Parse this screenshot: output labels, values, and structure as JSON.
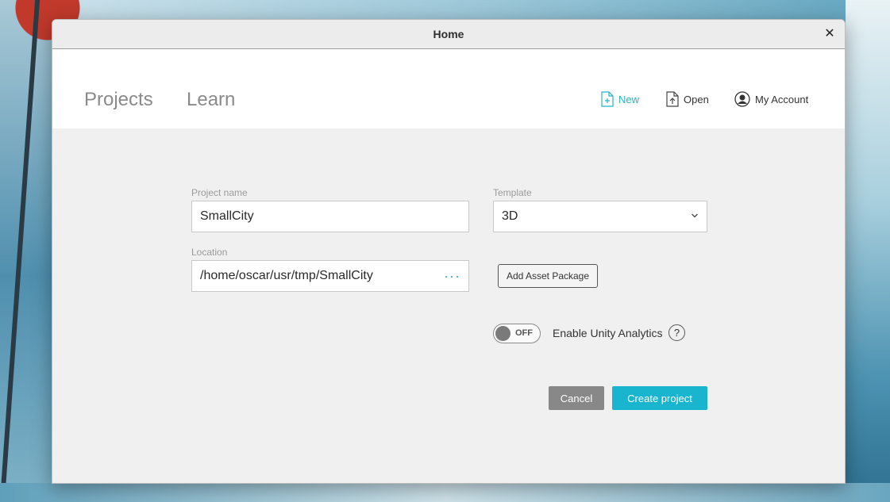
{
  "window": {
    "title": "Home"
  },
  "header": {
    "tabs": [
      {
        "label": "Projects"
      },
      {
        "label": "Learn"
      }
    ],
    "actions": {
      "new_label": "New",
      "open_label": "Open",
      "account_label": "My Account"
    },
    "accent_color": "#26b3c9"
  },
  "form": {
    "project_name_label": "Project name",
    "project_name_value": "SmallCity",
    "template_label": "Template",
    "template_value": "3D",
    "location_label": "Location",
    "location_value": "/home/oscar/usr/tmp/SmallCity",
    "location_browse": "···",
    "add_asset_label": "Add Asset Package",
    "analytics_toggle_state": "OFF",
    "analytics_label": "Enable Unity Analytics",
    "help_glyph": "?",
    "cancel_label": "Cancel",
    "create_label": "Create project"
  },
  "icons": {
    "close": "close-icon",
    "new": "new-file-icon",
    "open": "open-file-icon",
    "account": "account-icon",
    "template_dropdown": "chevron-down-icon",
    "help": "help-icon"
  },
  "colors": {
    "create_button": "#19b4cd",
    "cancel_button": "#888888"
  }
}
